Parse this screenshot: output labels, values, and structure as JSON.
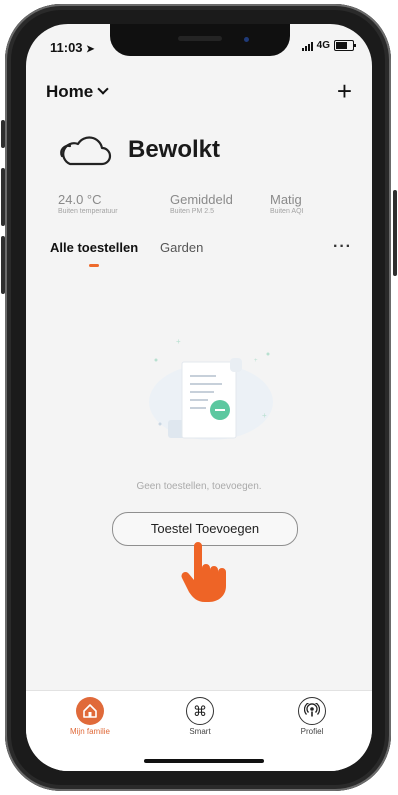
{
  "status_bar": {
    "time": "11:03",
    "network": "4G"
  },
  "header": {
    "title": "Home",
    "add_icon": "plus-icon"
  },
  "weather": {
    "condition": "Bewolkt",
    "icon": "cloud-icon"
  },
  "stats": [
    {
      "value": "24.0 °C",
      "label": "Buiten temperatuur"
    },
    {
      "value": "Gemiddeld",
      "label": "Buiten PM 2.5"
    },
    {
      "value": "Matig",
      "label": "Buiten AQI"
    }
  ],
  "tabs": [
    {
      "label": "Alle toestellen",
      "active": true
    },
    {
      "label": "Garden",
      "active": false
    }
  ],
  "more_label": "···",
  "empty": {
    "message": "Geen toestellen, toevoegen.",
    "button_label": "Toestel Toevoegen"
  },
  "tabbar": [
    {
      "label": "Mijn familie",
      "icon": "home-icon",
      "active": true
    },
    {
      "label": "Smart",
      "icon": "command-icon",
      "active": false
    },
    {
      "label": "Profiel",
      "icon": "podcast-icon",
      "active": false
    }
  ],
  "colors": {
    "accent": "#e06a3a",
    "background": "#f4f4f4"
  }
}
